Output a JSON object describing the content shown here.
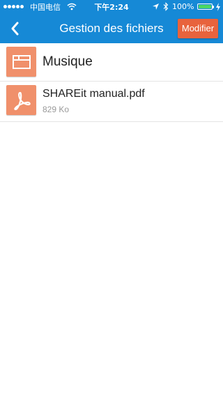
{
  "status_bar": {
    "carrier": "中国电信",
    "time": "下午2:24",
    "battery_percent": "100%",
    "battery_level": 1.0,
    "icons": [
      "signal-dots-icon",
      "wifi-icon",
      "location-arrow-icon",
      "bluetooth-icon",
      "battery-icon",
      "charging-icon"
    ]
  },
  "nav": {
    "title": "Gestion des fichiers",
    "modify_label": "Modifier",
    "back_icon": "chevron-left-icon"
  },
  "colors": {
    "header_blue": "#1689d6",
    "modify_orange": "#e8633d",
    "thumb_orange": "#f0906b"
  },
  "files": [
    {
      "name": "Musique",
      "type": "folder",
      "icon": "folder-icon"
    },
    {
      "name": "SHAREit manual.pdf",
      "size": "829 Ko",
      "type": "pdf",
      "icon": "pdf-icon"
    }
  ]
}
